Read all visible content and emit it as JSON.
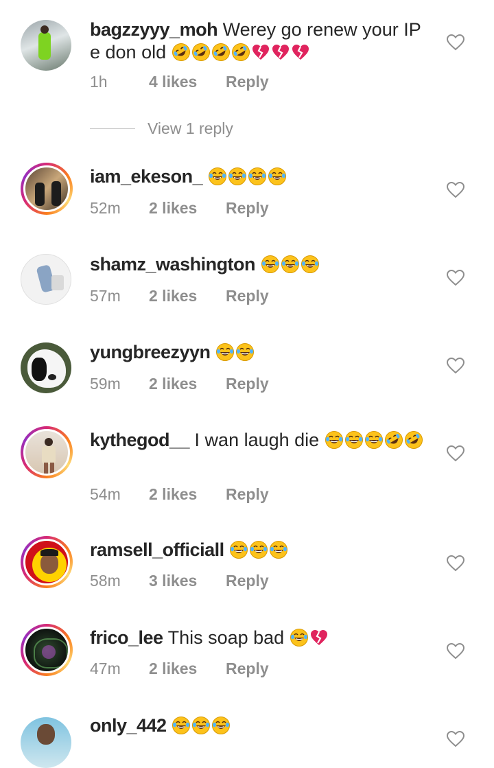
{
  "comments": [
    {
      "username": "bagzzyyy_moh",
      "text": " Werey go renew your IP e don old",
      "emojis_after": [
        "rofl",
        "rofl",
        "rofl",
        "rofl",
        "broken-heart",
        "broken-heart",
        "broken-heart"
      ],
      "time": "1h",
      "likes": "4 likes",
      "reply": "Reply",
      "view_replies": "View 1 reply"
    },
    {
      "username": "iam_ekeson_",
      "text": " ",
      "emojis_after": [
        "joy",
        "joy",
        "joy",
        "joy"
      ],
      "time": "52m",
      "likes": "2 likes",
      "reply": "Reply"
    },
    {
      "username": "shamz_washington",
      "text": " ",
      "emojis_after": [
        "joy",
        "joy",
        "joy"
      ],
      "time": "57m",
      "likes": "2 likes",
      "reply": "Reply"
    },
    {
      "username": "yungbreezyyn",
      "text": " ",
      "emojis_after": [
        "joy",
        "joy"
      ],
      "time": "59m",
      "likes": "2 likes",
      "reply": "Reply"
    },
    {
      "username": "kythegod__",
      "text": " I wan laugh die ",
      "emojis_after": [
        "joy",
        "joy",
        "joy",
        "rofl",
        "rofl"
      ],
      "time": "54m",
      "likes": "2 likes",
      "reply": "Reply"
    },
    {
      "username": "ramsell_officiall",
      "text": " ",
      "emojis_after": [
        "joy",
        "joy",
        "joy"
      ],
      "time": "58m",
      "likes": "3 likes",
      "reply": "Reply"
    },
    {
      "username": "frico_lee",
      "text": " This soap bad ",
      "emojis_after": [
        "joy",
        "broken-heart"
      ],
      "time": "47m",
      "likes": "2 likes",
      "reply": "Reply"
    },
    {
      "username": "only_442",
      "text": " ",
      "emojis_after": [
        "joy",
        "joy",
        "joy"
      ],
      "time": "",
      "likes": "",
      "reply": ""
    }
  ],
  "colors": {
    "text": "#262626",
    "meta": "#8e8e8e",
    "emoji_yellow": "#fcc21b",
    "broken_heart": "#e0245e"
  }
}
